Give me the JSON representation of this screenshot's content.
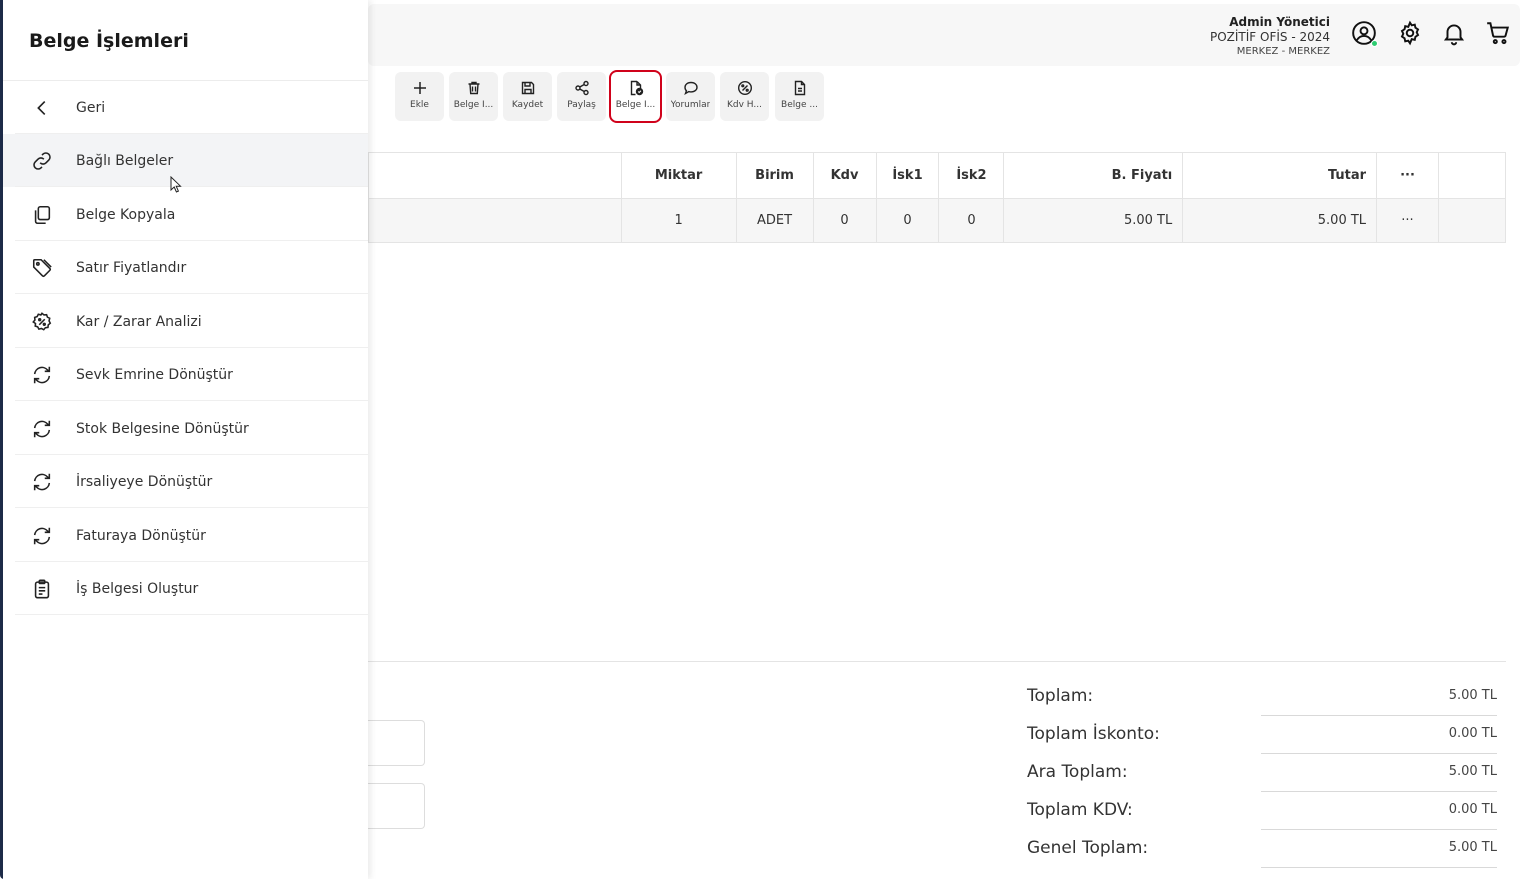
{
  "header": {
    "user_name": "Admin Yönetici",
    "company": "POZİTİF OFİS - 2024",
    "branch": "MERKEZ - MERKEZ"
  },
  "toolbar": [
    {
      "label": "Ekle",
      "icon": "plus-icon"
    },
    {
      "label": "Belge İ...",
      "icon": "trash-icon"
    },
    {
      "label": "Kaydet",
      "icon": "save-icon"
    },
    {
      "label": "Paylaş",
      "icon": "share-icon"
    },
    {
      "label": "Belge İ...",
      "icon": "document-check-icon"
    },
    {
      "label": "Yorumlar",
      "icon": "comment-icon"
    },
    {
      "label": "Kdv H...",
      "icon": "percent-icon"
    },
    {
      "label": "Belge ...",
      "icon": "document-icon"
    }
  ],
  "table": {
    "columns": [
      "Miktar",
      "Birim",
      "Kdv",
      "İsk1",
      "İsk2",
      "B. Fiyatı",
      "Tutar",
      "···"
    ],
    "rows": [
      [
        "1",
        "ADET",
        "0",
        "0",
        "0",
        "5.00 TL",
        "5.00 TL",
        "···"
      ]
    ]
  },
  "totals": [
    {
      "label": "Toplam:",
      "value": "5.00 TL"
    },
    {
      "label": "Toplam İskonto:",
      "value": "0.00 TL"
    },
    {
      "label": "Ara Toplam:",
      "value": "5.00 TL"
    },
    {
      "label": "Toplam KDV:",
      "value": "0.00 TL"
    },
    {
      "label": "Genel Toplam:",
      "value": "5.00 TL"
    }
  ],
  "drawer": {
    "title": "Belge İşlemleri",
    "items": [
      {
        "label": "Geri",
        "icon": "chevron-left-icon"
      },
      {
        "label": "Bağlı Belgeler",
        "icon": "link-icon"
      },
      {
        "label": "Belge Kopyala",
        "icon": "copy-icon"
      },
      {
        "label": "Satır Fiyatlandır",
        "icon": "tag-icon"
      },
      {
        "label": "Kar / Zarar Analizi",
        "icon": "percent-badge-icon"
      },
      {
        "label": "Sevk Emrine Dönüştür",
        "icon": "refresh-icon"
      },
      {
        "label": "Stok Belgesine Dönüştür",
        "icon": "refresh-icon"
      },
      {
        "label": "İrsaliyeye Dönüştür",
        "icon": "refresh-icon"
      },
      {
        "label": "Faturaya Dönüştür",
        "icon": "refresh-icon"
      },
      {
        "label": "İş Belgesi Oluştur",
        "icon": "clipboard-icon"
      }
    ]
  },
  "colors": {
    "highlight": "#d0021b",
    "drawer_edge": "#1d2b48",
    "online": "#2ecc71"
  }
}
